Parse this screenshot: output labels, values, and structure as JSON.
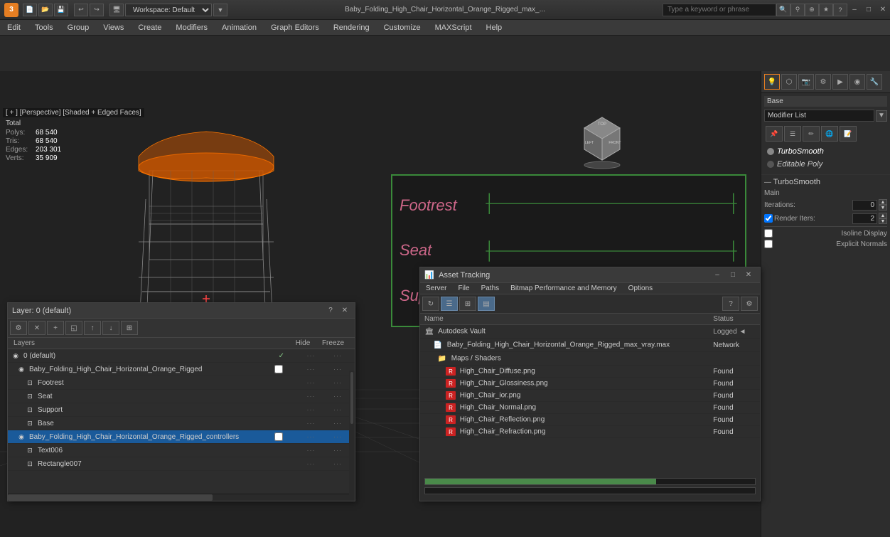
{
  "titlebar": {
    "logo": "3",
    "title": "Baby_Folding_High_Chair_Horizontal_Orange_Rigged_max_...",
    "workspace_label": "Workspace: Default",
    "search_placeholder": "Type a keyword or phrase",
    "win_minimize": "–",
    "win_restore": "□",
    "win_close": "✕"
  },
  "menubar": {
    "items": [
      "Edit",
      "Tools",
      "Group",
      "Views",
      "Create",
      "Modifiers",
      "Animation",
      "Graph Editors",
      "Rendering",
      "Customize",
      "MAXScript",
      "Help"
    ]
  },
  "viewport": {
    "label": "[ + ] [Perspective] [Shaded + Edged Faces]",
    "stats": {
      "total_label": "Total",
      "polys_label": "Polys:",
      "polys_value": "68 540",
      "tris_label": "Tris:",
      "tris_value": "68 540",
      "edges_label": "Edges:",
      "edges_value": "203 301",
      "verts_label": "Verts:",
      "verts_value": "35 909"
    }
  },
  "graph_editor": {
    "labels": [
      "Footrest",
      "Seat",
      "Support"
    ]
  },
  "right_panel": {
    "base_label": "Base",
    "modifier_list_label": "Modifier List",
    "modifiers": [
      {
        "name": "TurboSmooth",
        "active": true
      },
      {
        "name": "Editable Poly",
        "active": false
      }
    ],
    "turbosmooth": {
      "header": "TurboSmooth",
      "main_label": "Main",
      "iterations_label": "Iterations:",
      "iterations_value": "0",
      "render_iters_label": "Render Iters:",
      "render_iters_value": "2",
      "isoline_label": "Isoline Display",
      "explicit_label": "Explicit Normals"
    }
  },
  "layers_panel": {
    "title": "Layer: 0 (default)",
    "header_name": "Layers",
    "header_hide": "Hide",
    "header_freeze": "Freeze",
    "layers": [
      {
        "indent": 0,
        "icon": "◉",
        "name": "0 (default)",
        "checked": true,
        "selected": false
      },
      {
        "indent": 1,
        "icon": "◉",
        "name": "Baby_Folding_High_Chair_Horizontal_Orange_Rigged",
        "checked": false,
        "selected": false
      },
      {
        "indent": 2,
        "icon": "⊡",
        "name": "Footrest",
        "checked": false,
        "selected": false
      },
      {
        "indent": 2,
        "icon": "⊡",
        "name": "Seat",
        "checked": false,
        "selected": false
      },
      {
        "indent": 2,
        "icon": "⊡",
        "name": "Support",
        "checked": false,
        "selected": false
      },
      {
        "indent": 2,
        "icon": "⊡",
        "name": "Base",
        "checked": false,
        "selected": false
      },
      {
        "indent": 1,
        "icon": "◉",
        "name": "Baby_Folding_High_Chair_Horizontal_Orange_Rigged_controllers",
        "checked": false,
        "selected": true
      },
      {
        "indent": 2,
        "icon": "⊡",
        "name": "Text006",
        "checked": false,
        "selected": false
      },
      {
        "indent": 2,
        "icon": "⊡",
        "name": "Rectangle007",
        "checked": false,
        "selected": false
      }
    ]
  },
  "asset_panel": {
    "title": "Asset Tracking",
    "menus": [
      "Server",
      "File",
      "Paths",
      "Bitmap Performance and Memory",
      "Options"
    ],
    "columns": [
      "Name",
      "Status"
    ],
    "assets": [
      {
        "type": "vault",
        "icon": "🏛",
        "name": "Autodesk Vault",
        "status": "",
        "status_class": ""
      },
      {
        "type": "file",
        "icon": "📄",
        "name": "Baby_Folding_High_Chair_Horizontal_Orange_Rigged_max_vray.max",
        "status": "Network",
        "status_class": "status-network"
      },
      {
        "type": "folder",
        "icon": "📁",
        "name": "Maps / Shaders",
        "status": "",
        "status_class": ""
      },
      {
        "type": "png",
        "icon": "🖼",
        "name": "High_Chair_Diffuse.png",
        "status": "Found",
        "status_class": "status-found"
      },
      {
        "type": "png",
        "icon": "🖼",
        "name": "High_Chair_Glossiness.png",
        "status": "Found",
        "status_class": "status-found"
      },
      {
        "type": "png",
        "icon": "🖼",
        "name": "High_Chair_ior.png",
        "status": "Found",
        "status_class": "status-found"
      },
      {
        "type": "png",
        "icon": "🖼",
        "name": "High_Chair_Normal.png",
        "status": "Found",
        "status_class": "status-found"
      },
      {
        "type": "png",
        "icon": "🖼",
        "name": "High_Chair_Reflection.png",
        "status": "Found",
        "status_class": "status-found"
      },
      {
        "type": "png",
        "icon": "🖼",
        "name": "High_Chair_Refraction.png",
        "status": "Found",
        "status_class": "status-found"
      }
    ]
  }
}
